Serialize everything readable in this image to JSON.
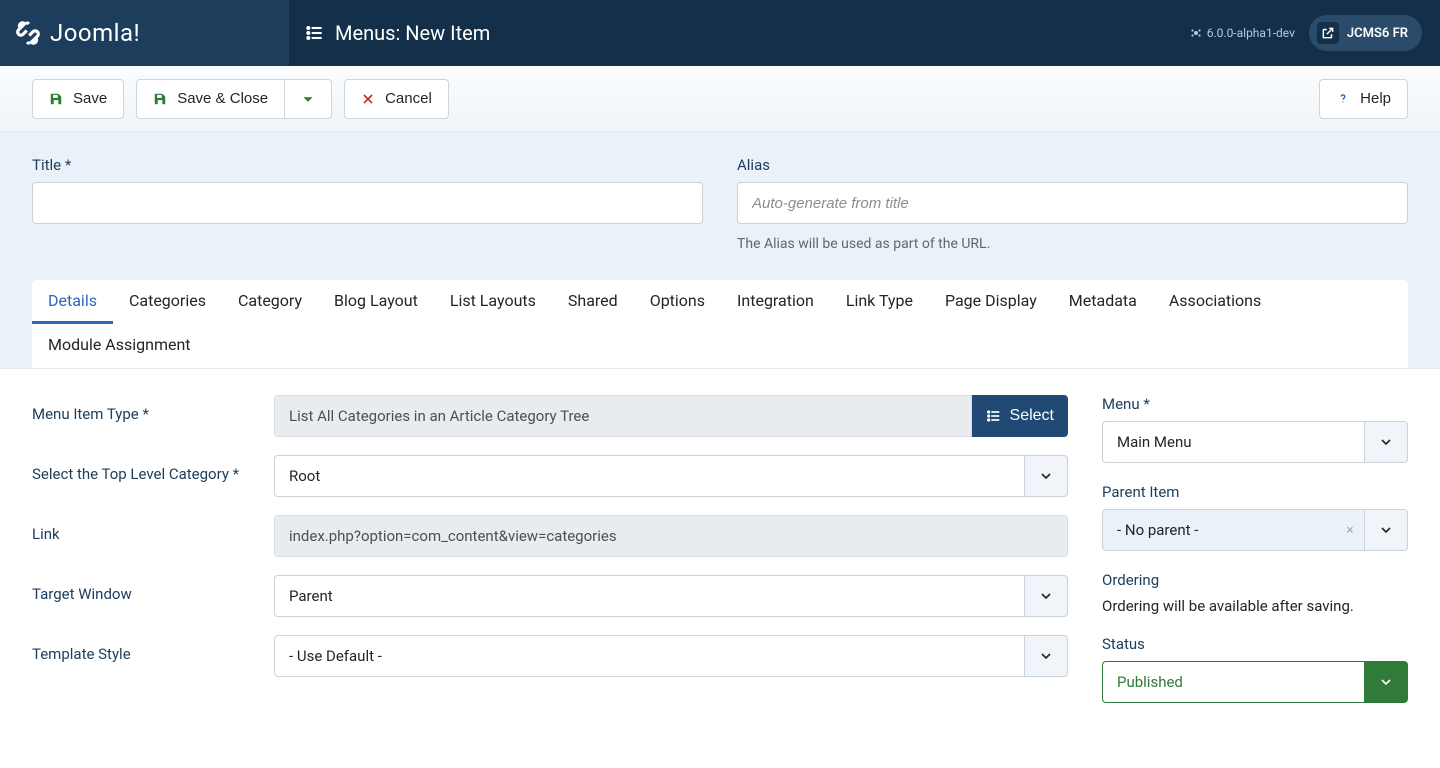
{
  "header": {
    "brand_name": "Joomla!",
    "page_title": "Menus: New Item",
    "version": "6.0.0-alpha1-dev",
    "site_badge": "JCMS6 FR"
  },
  "toolbar": {
    "save": "Save",
    "save_close": "Save & Close",
    "cancel": "Cancel",
    "help": "Help"
  },
  "form_head": {
    "title_label": "Title *",
    "title_value": "",
    "alias_label": "Alias",
    "alias_placeholder": "Auto-generate from title",
    "alias_help": "The Alias will be used as part of the URL."
  },
  "tabs": [
    "Details",
    "Categories",
    "Category",
    "Blog Layout",
    "List Layouts",
    "Shared",
    "Options",
    "Integration",
    "Link Type",
    "Page Display",
    "Metadata",
    "Associations",
    "Module Assignment"
  ],
  "active_tab": 0,
  "details": {
    "menu_item_type": {
      "label": "Menu Item Type *",
      "value": "List All Categories in an Article Category Tree",
      "select_btn": "Select"
    },
    "top_level_cat": {
      "label": "Select the Top Level Category *",
      "value": "Root"
    },
    "link": {
      "label": "Link",
      "value": "index.php?option=com_content&view=categories"
    },
    "target_window": {
      "label": "Target Window",
      "value": "Parent"
    },
    "template_style": {
      "label": "Template Style",
      "value": "- Use Default -"
    }
  },
  "side": {
    "menu": {
      "label": "Menu *",
      "value": "Main Menu"
    },
    "parent_item": {
      "label": "Parent Item",
      "value": "- No parent -"
    },
    "ordering": {
      "label": "Ordering",
      "text": "Ordering will be available after saving."
    },
    "status": {
      "label": "Status",
      "value": "Published"
    }
  }
}
